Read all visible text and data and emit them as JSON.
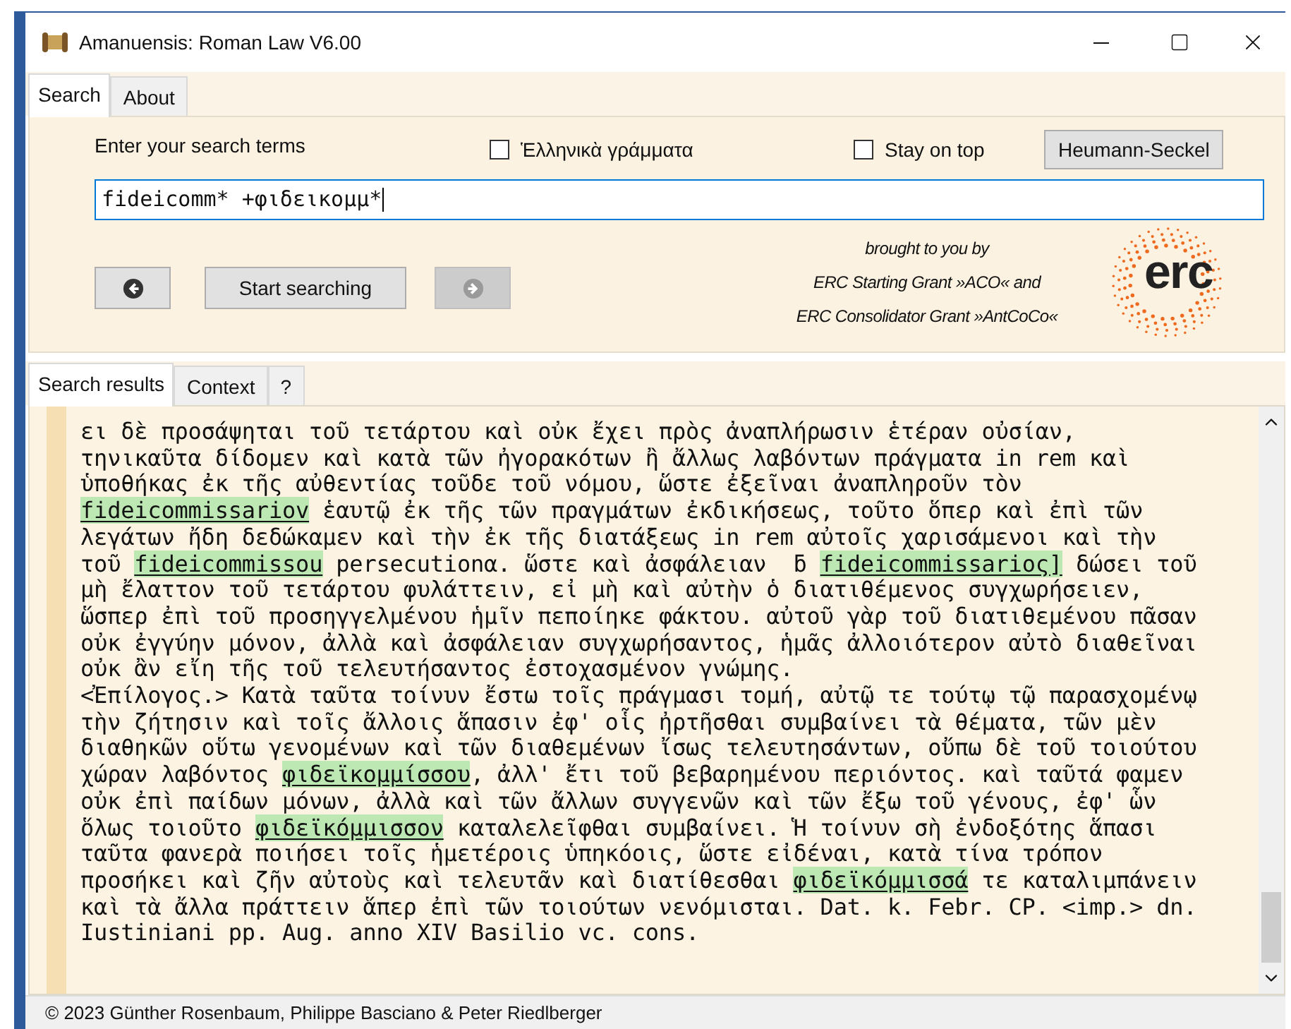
{
  "window": {
    "title": "Amanuensis: Roman Law V6.00"
  },
  "main_tabs": [
    {
      "label": "Search",
      "selected": true
    },
    {
      "label": "About",
      "selected": false
    }
  ],
  "search_panel": {
    "prompt": "Enter your search terms",
    "checkboxes": [
      {
        "label": "Ἑλληνικὰ γράμματα",
        "checked": false
      },
      {
        "label": "Stay on top",
        "checked": false
      }
    ],
    "dictionary_button": "Heumann-Seckel",
    "query": "fideicomm* +φιδεικομμ*",
    "back_button": {
      "disabled": false
    },
    "start_button": "Start searching",
    "forward_button": {
      "disabled": true
    },
    "credits": [
      "brought to you by",
      "ERC Starting Grant »ACO« and",
      "ERC Consolidator Grant »AntCoCo«"
    ],
    "logo_text": "erc"
  },
  "result_tabs": [
    {
      "label": "Search results",
      "selected": true
    },
    {
      "label": "Context",
      "selected": false
    },
    {
      "label": "?",
      "selected": false
    }
  ],
  "results": [
    [
      {
        "text": "ει δὲ προσάψηται τοῦ τετάρτου καὶ οὐκ ἔχει πρὸς ἀναπλήρωσιν ἑτέραν οὐσίαν,",
        "highlighted": false
      }
    ],
    [
      {
        "text": "τηνικαῦτα δίδομεν καὶ κατὰ τῶν ἠγορακότων ἢ ἄλλως λαβόντων πράγματα in rem καὶ",
        "highlighted": false
      }
    ],
    [
      {
        "text": "ὑποθήκας ἐκ τῆς αὐθεντίας τοῦδε τοῦ νόμου, ὥστε ἐξεῖναι ἀναπληροῦν τὸν",
        "highlighted": false
      }
    ],
    [
      {
        "text": "fideicommissariov",
        "highlighted": true
      },
      {
        "text": " ἑαυτῷ ἐκ τῆς τῶν πραγμάτων ἐκδικήσεως, τοῦτο ὅπερ καὶ ἐπὶ τῶν",
        "highlighted": false
      }
    ],
    [
      {
        "text": "λεγάτων ἤδη δεδώκαμεν καὶ τὴν ἐκ τῆς διατάξεως in rem αὐτοῖς χαρισάμενοι καὶ τὴν",
        "highlighted": false
      }
    ],
    [
      {
        "text": "τοῦ ",
        "highlighted": false
      },
      {
        "text": "fideicommissou",
        "highlighted": true
      },
      {
        "text": " persecutionα. ὥστε καὶ ἀσφάλειαν  ƃ ",
        "highlighted": false
      },
      {
        "text": "fideicommissarioς]",
        "highlighted": true
      },
      {
        "text": " δώσει τοῦ",
        "highlighted": false
      }
    ],
    [
      {
        "text": "μὴ ἔλαττον τοῦ τετάρτου φυλάττειν, εἰ μὴ καὶ αὐτὴν ὁ διατιθέμενος συγχωρήσειεν,",
        "highlighted": false
      }
    ],
    [
      {
        "text": "ὥσπερ ἐπὶ τοῦ προσηγγελμένου ἡμῖν πεποίηκε φάκτου. αὐτοῦ γὰρ τοῦ διατιθεμένου πᾶσαν",
        "highlighted": false
      }
    ],
    [
      {
        "text": "οὐκ ἐγγύην μόνον, ἀλλὰ καὶ ἀσφάλειαν συγχωρήσαντος, ἡμᾶς ἀλλοιότερον αὐτὸ διαθεῖναι",
        "highlighted": false
      }
    ],
    [
      {
        "text": "οὐκ ἂν εἴη τῆς τοῦ τελευτήσαντος ἐστοχασμένον γνώμης.",
        "highlighted": false
      }
    ],
    [
      {
        "text": "<Ἐπίλογος.> Κατὰ ταῦτα τοίνυν ἔστω τοῖς πράγμασι τομή, αὐτῷ τε τούτῳ τῷ παρασχομένῳ",
        "highlighted": false
      }
    ],
    [
      {
        "text": "τὴν ζήτησιν καὶ τοῖς ἄλλοις ἅπασιν ἐφ' οἷς ἠρτῆσθαι συμβαίνει τὰ θέματα, τῶν μὲν",
        "highlighted": false
      }
    ],
    [
      {
        "text": "διαθηκῶν οὕτω γενομένων καὶ τῶν διαθεμένων ἴσως τελευτησάντων, οὔπω δὲ τοῦ τοιούτου",
        "highlighted": false
      }
    ],
    [
      {
        "text": "χώραν λαβόντος ",
        "highlighted": false
      },
      {
        "text": "φιδεϊκομμίσσου",
        "highlighted": true
      },
      {
        "text": ", ἀλλ' ἔτι τοῦ βεβαρημένου περιόντος. καὶ ταῦτά φαμεν",
        "highlighted": false
      }
    ],
    [
      {
        "text": "οὐκ ἐπὶ παίδων μόνων, ἀλλὰ καὶ τῶν ἄλλων συγγενῶν καὶ τῶν ἔξω τοῦ γένους, ἐφ' ὧν",
        "highlighted": false
      }
    ],
    [
      {
        "text": "ὅλως τοιοῦτο ",
        "highlighted": false
      },
      {
        "text": "φιδεϊκόμμισσον",
        "highlighted": true
      },
      {
        "text": " καταλελεῖφθαι συμβαίνει. Ἡ τοίνυν σὴ ἐνδοξότης ἅπασι",
        "highlighted": false
      }
    ],
    [
      {
        "text": "ταῦτα φανερὰ ποιήσει τοῖς ἡμετέροις ὑπηκόοις, ὥστε εἰδέναι, κατὰ τίνα τρόπον",
        "highlighted": false
      }
    ],
    [
      {
        "text": "προσήκει καὶ ζῆν αὐτοὺς καὶ τελευτᾶν καὶ διατίθεσθαι ",
        "highlighted": false
      },
      {
        "text": "φιδεϊκόμμισσά",
        "highlighted": true
      },
      {
        "text": " τε καταλιμπάνειν",
        "highlighted": false
      }
    ],
    [
      {
        "text": "καὶ τὰ ἄλλα πράττειν ἅπερ ἐπὶ τῶν τοιούτων νενόμισται. Dat. k. Febr. CP. <imp.> dn.",
        "highlighted": false
      }
    ],
    [
      {
        "text": "Iustiniani pp. Aug. anno XIV Basilio vc. cons.",
        "highlighted": false
      }
    ]
  ],
  "status_bar": "© 2023 Günther Rosenbaum, Philippe Basciano & Peter Riedlberger"
}
